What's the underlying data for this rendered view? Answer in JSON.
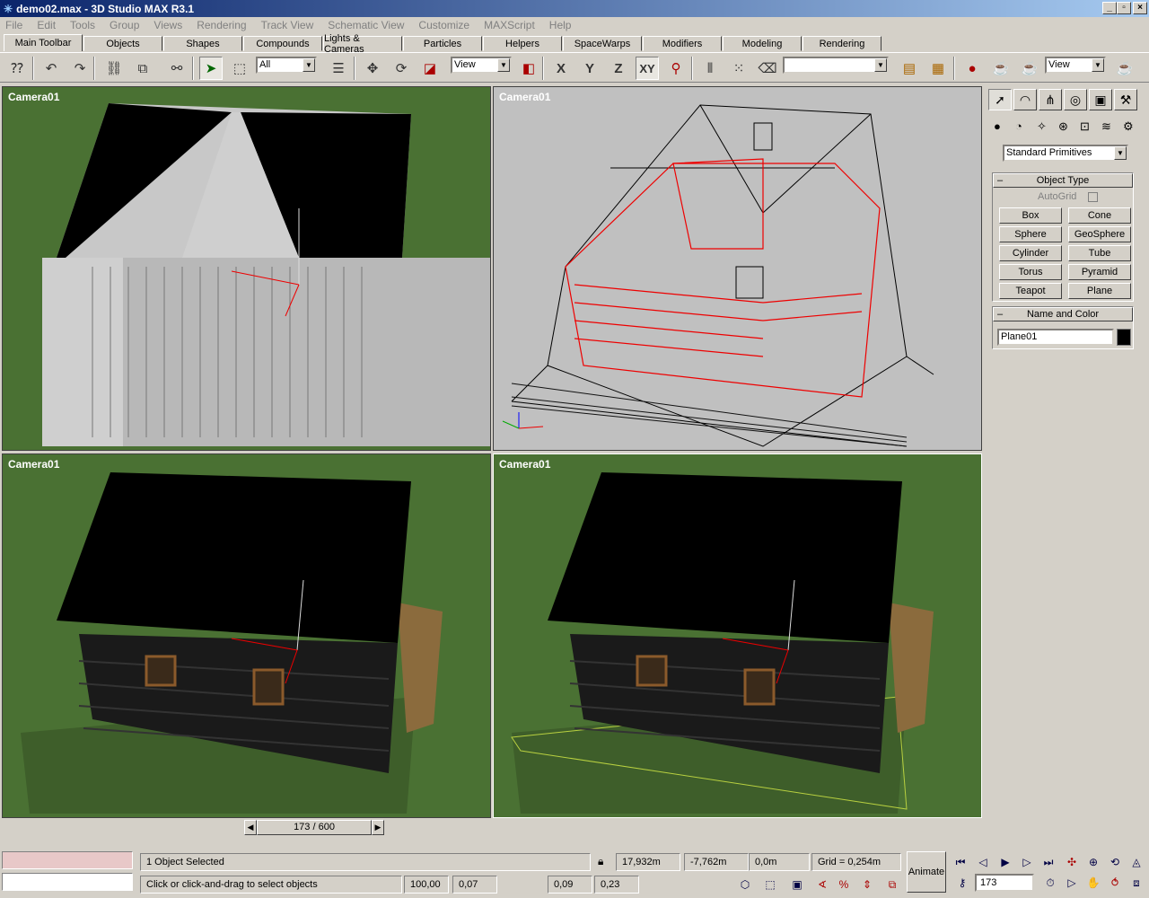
{
  "window": {
    "title": "demo02.max - 3D Studio MAX R3.1"
  },
  "menu": [
    "File",
    "Edit",
    "Tools",
    "Group",
    "Views",
    "Rendering",
    "Track View",
    "Schematic View",
    "Customize",
    "MAXScript",
    "Help"
  ],
  "tabs": [
    "Main Toolbar",
    "Objects",
    "Shapes",
    "Compounds",
    "Lights & Cameras",
    "Particles",
    "Helpers",
    "SpaceWarps",
    "Modifiers",
    "Modeling",
    "Rendering"
  ],
  "toolbar": {
    "selection_filter": "All",
    "ref_coord": "View",
    "axis_x": "X",
    "axis_y": "Y",
    "axis_z": "Z",
    "axis_xy": "XY",
    "named_selection": "",
    "render_view": "View"
  },
  "viewports": {
    "top_left": "Camera01",
    "top_right": "Camera01",
    "bottom_left": "Camera01",
    "bottom_right": "Camera01"
  },
  "panel": {
    "category": "Standard Primitives",
    "object_type_header": "Object Type",
    "autogrid": "AutoGrid",
    "buttons": [
      "Box",
      "Cone",
      "Sphere",
      "GeoSphere",
      "Cylinder",
      "Tube",
      "Torus",
      "Pyramid",
      "Teapot",
      "Plane"
    ],
    "name_color_header": "Name and Color",
    "object_name": "Plane01",
    "object_color": "#000000"
  },
  "timeslider": {
    "label": "173 / 600",
    "current": 173,
    "total": 600
  },
  "status": {
    "selected": "1 Object Selected",
    "prompt": "Click or click-and-drag to select objects",
    "x": "17,932m",
    "y": "-7,762m",
    "z": "0,0m",
    "grid": "Grid = 0,254m",
    "animate": "Animate",
    "frame": "173",
    "vals": [
      "100,00",
      "0,07",
      "0,09",
      "0,23"
    ]
  },
  "colors": {
    "viewport_bg": "#4a7133",
    "wire_bg": "#c0c0c0",
    "accent": "#0a246a"
  }
}
